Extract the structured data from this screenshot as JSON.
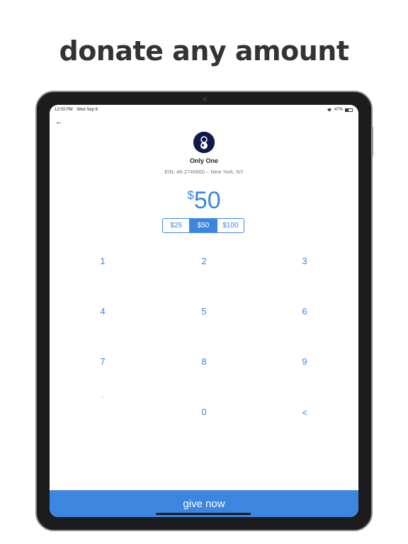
{
  "headline": "donate any amount",
  "status": {
    "time": "12:03 PM",
    "date": "Wed Sep 6",
    "battery": "47%"
  },
  "organization": {
    "name": "Only One",
    "ein_location": "EIN: 46-2746860 – New York, NY"
  },
  "amount": {
    "currency": "$",
    "value": "50"
  },
  "presets": [
    {
      "label": "$25",
      "selected": false
    },
    {
      "label": "$50",
      "selected": true
    },
    {
      "label": "$100",
      "selected": false
    }
  ],
  "keypad": [
    "1",
    "2",
    "3",
    "4",
    "5",
    "6",
    "7",
    "8",
    "9",
    ".",
    "0",
    "<"
  ],
  "give_button": "give now",
  "colors": {
    "accent": "#3d86e0",
    "headline": "#333333",
    "logo_bg": "#0e1a4a"
  }
}
